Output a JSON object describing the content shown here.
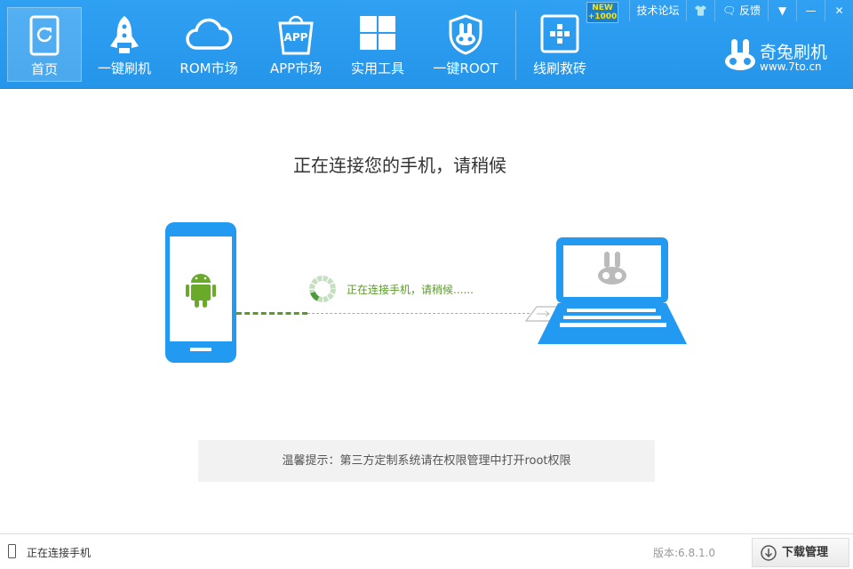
{
  "nav": {
    "tabs": [
      {
        "label": "首页",
        "icon": "phone-refresh-icon"
      },
      {
        "label": "一键刷机",
        "icon": "rocket-icon"
      },
      {
        "label": "ROM市场",
        "icon": "cloud-icon"
      },
      {
        "label": "APP市场",
        "icon": "app-bag-icon",
        "icon_text": "APP"
      },
      {
        "label": "实用工具",
        "icon": "grid-icon"
      },
      {
        "label": "一键ROOT",
        "icon": "rabbit-shield-icon"
      },
      {
        "label": "线刷救砖",
        "icon": "plus-box-icon"
      }
    ]
  },
  "badge": {
    "line1": "NEW",
    "line2": "+1000"
  },
  "controls": {
    "forum": "技术论坛",
    "feedback": "反馈"
  },
  "logo": {
    "name": "奇兔刷机",
    "url": "www.7to.cn"
  },
  "main": {
    "title": "正在连接您的手机，请稍候",
    "status": "正在连接手机，请稍候......",
    "tip": "温馨提示：第三方定制系统请在权限管理中打开root权限"
  },
  "footer": {
    "connection": "正在连接手机",
    "version": "版本:6.8.1.0",
    "download": "下载管理"
  },
  "colors": {
    "header": "#2b9bf0",
    "accent_green": "#5a9a2a",
    "device_blue": "#239af2"
  }
}
